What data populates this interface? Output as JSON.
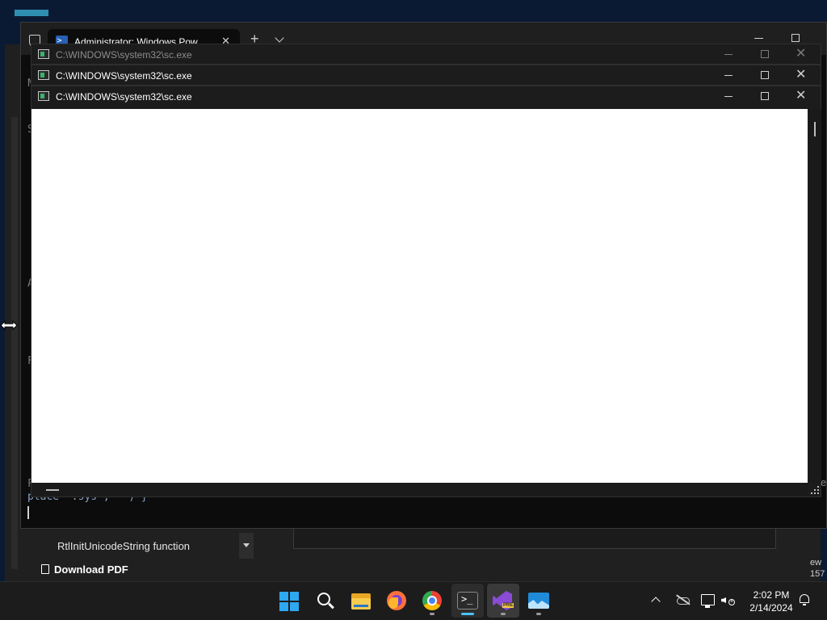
{
  "terminal": {
    "tab_title": "Administrator: Windows Pow",
    "tab_close": "✕",
    "new_tab": "+",
    "prompt_line": "place *.sys , \"\") }",
    "side_letters": [
      "S",
      "A",
      "F",
      "F",
      "N"
    ]
  },
  "sc_windows": [
    {
      "title": "C:\\WINDOWS\\system32\\sc.exe",
      "state": "inactive"
    },
    {
      "title": "C:\\WINDOWS\\system32\\sc.exe",
      "state": "active"
    },
    {
      "title": "C:\\WINDOWS\\system32\\sc.exe",
      "state": "active"
    }
  ],
  "doc": {
    "rtl_item": "RtlInitUnicodeString function",
    "download_pdf": "Download PDF",
    "right_edge_top": "e",
    "right_edge_line1": "ew",
    "right_edge_line2": "157"
  },
  "taskbar": {
    "apps": [
      "start-icon",
      "search-icon",
      "file-explorer-icon",
      "firefox-icon",
      "chrome-icon",
      "terminal-icon",
      "visual-studio-preview-icon",
      "photos-icon"
    ],
    "vs_badge": "PRE",
    "time": "2:02 PM",
    "date": "2/14/2024"
  },
  "colors": {
    "accent": "#4cc2ff",
    "taskbar_bg": "#1c1c1c",
    "window_bg": "#1c1c1c",
    "content_bg": "#ffffff"
  }
}
